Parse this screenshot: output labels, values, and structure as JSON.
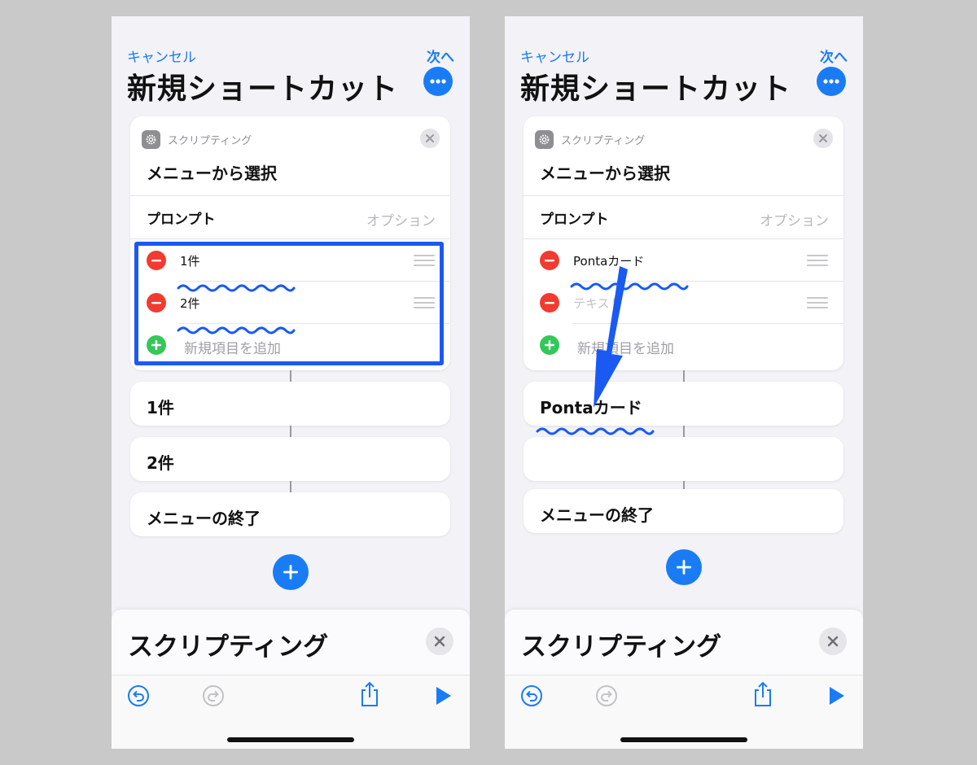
{
  "left": {
    "nav": {
      "cancel": "キャンセル",
      "next": "次へ"
    },
    "title": "新規ショートカット",
    "action_card": {
      "category": "スクリプティング",
      "name": "メニューから選択",
      "prompt_label": "プロンプト",
      "prompt_value": "オプション",
      "items": [
        "1件",
        "2件"
      ],
      "add_item": "新規項目を追加"
    },
    "menu_cases": [
      "1件",
      "2件"
    ],
    "menu_end": "メニューの終了",
    "sheet_title": "スクリプティング"
  },
  "right": {
    "nav": {
      "cancel": "キャンセル",
      "next": "次へ"
    },
    "title": "新規ショートカット",
    "action_card": {
      "category": "スクリプティング",
      "name": "メニューから選択",
      "prompt_label": "プロンプト",
      "prompt_value": "オプション",
      "item_1": "Pontaカード",
      "item_2_placeholder": "テキスト",
      "add_item": "新規項目を追加"
    },
    "menu_cases": [
      "Pontaカード",
      ""
    ],
    "menu_end": "メニューの終了",
    "sheet_title": "スクリプティング"
  },
  "icons": {
    "more": "ellipsis-circle-icon",
    "gear": "gear-icon",
    "close": "close-icon",
    "minus": "minus-circle-icon",
    "plus": "plus-circle-icon",
    "drag": "drag-handle-icon",
    "undo": "undo-icon",
    "redo": "redo-icon",
    "share": "share-icon",
    "play": "play-icon"
  },
  "colors": {
    "accent": "#1a7cf5",
    "delete": "#f23b30",
    "add": "#34c759",
    "annotation": "#1a5af2",
    "background": "#f2f2f7"
  }
}
